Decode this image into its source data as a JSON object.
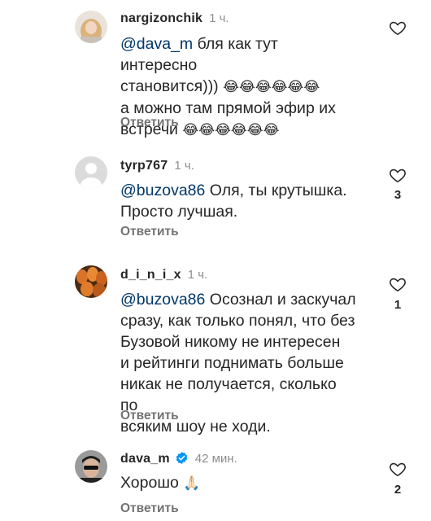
{
  "comments": [
    {
      "username": "nargizonchik",
      "time": "1 ч.",
      "mention": "@dava_m",
      "text": " бля как тут интересно\nстановится))) ",
      "emoji1": "😂😂😂😂😂😂",
      "text2": "\nа можно там прямой эфир их\nвстречи ",
      "emoji2": "😂😂😂😂😂😂",
      "reply": "Ответить",
      "likes": ""
    },
    {
      "username": "tyrp767",
      "time": "1 ч.",
      "mention": "@buzova86",
      "text": " Оля, ты крутышка.\nПросто лучшая.",
      "reply": "Ответить",
      "likes": "3"
    },
    {
      "username": "d_i_n_i_x",
      "time": "1 ч.",
      "mention": "@buzova86",
      "text": " Осознал и заскучал\nсразу, как только понял, что без\nБузовой никому не интересен\nи рейтинги поднимать больше\nникак не получается, сколько по\nвсяким шоу не ходи.",
      "reply": "Ответить",
      "likes": "1"
    },
    {
      "username": "dava_m",
      "time": "42 мин.",
      "text": "Хорошо ",
      "emoji1": "🙏🏻",
      "reply": "Ответить",
      "likes": "2",
      "verified": true
    }
  ],
  "icons": {
    "heart": "heart-outline-icon",
    "verified": "verified-badge-icon"
  },
  "colors": {
    "text": "#262626",
    "secondary": "#8e8e8e",
    "mention": "#00376b",
    "verified": "#0095f6"
  }
}
